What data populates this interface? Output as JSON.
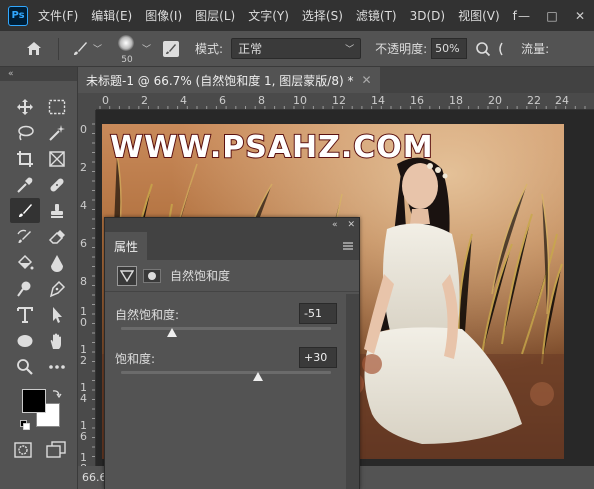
{
  "menubar": {
    "logo": "Ps",
    "items": [
      "文件(F)",
      "编辑(E)",
      "图像(I)",
      "图层(L)",
      "文字(Y)",
      "选择(S)",
      "滤镜(T)",
      "3D(D)",
      "视图(V)",
      "f"
    ],
    "controls": [
      "—",
      "□",
      "✕"
    ]
  },
  "options": {
    "brush_size": "50",
    "mode_label": "模式:",
    "mode_value": "正常",
    "opacity_label": "不透明度:",
    "opacity_value": "50%",
    "flow_label": "流量:"
  },
  "toolbar": {
    "collapse": "«"
  },
  "document": {
    "tab_title": "未标题-1 @ 66.7% (自然饱和度 1, 图层蒙版/8) *",
    "tab_close": "✕",
    "zoom": "66.6",
    "ruler_h": [
      "0",
      "2",
      "4",
      "6",
      "8",
      "10",
      "12",
      "14",
      "16",
      "18",
      "20",
      "22",
      "24"
    ],
    "ruler_v": [
      "0",
      "2",
      "4",
      "6",
      "8",
      "1\n0",
      "1\n2",
      "1\n4",
      "1\n6",
      "1\n8"
    ],
    "watermark": "WWW.PSAHZ.COM"
  },
  "panel": {
    "topbar_collapse": "«",
    "topbar_close": "✕",
    "tab": "属性",
    "title": "自然饱和度",
    "vibrance_label": "自然饱和度:",
    "vibrance_value": "-51",
    "vibrance_level": -51,
    "saturation_label": "饱和度:",
    "saturation_value": "+30",
    "saturation_level": 30
  },
  "colors": {
    "foreground": "#000000",
    "background": "#ffffff",
    "accent": "#31a8ff"
  }
}
